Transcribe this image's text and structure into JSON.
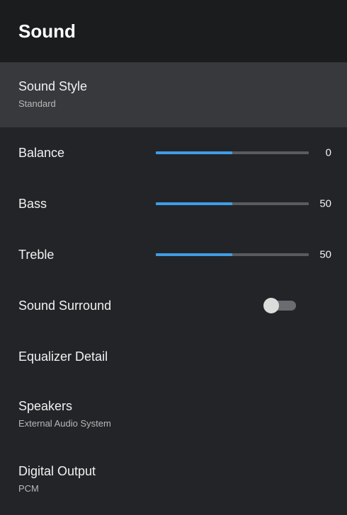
{
  "header": {
    "title": "Sound"
  },
  "items": {
    "sound_style": {
      "label": "Sound Style",
      "value": "Standard"
    },
    "balance": {
      "label": "Balance",
      "value": "0",
      "level": 0.5
    },
    "bass": {
      "label": "Bass",
      "value": "50",
      "level": 0.5
    },
    "treble": {
      "label": "Treble",
      "value": "50",
      "level": 0.5
    },
    "sound_surround": {
      "label": "Sound Surround",
      "state": "off"
    },
    "equalizer_detail": {
      "label": "Equalizer Detail"
    },
    "speakers": {
      "label": "Speakers",
      "value": "External Audio System"
    },
    "digital_output": {
      "label": "Digital Output",
      "value": "PCM"
    }
  },
  "colors": {
    "accent": "#3f9de6",
    "background": "#232427",
    "header_background": "#1b1c1e",
    "selected_background": "#38393c"
  }
}
